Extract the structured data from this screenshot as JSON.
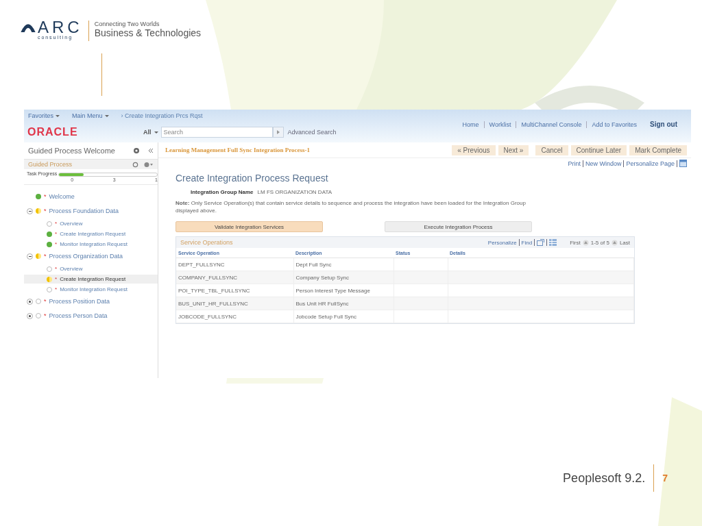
{
  "brand": {
    "logo": "ARC",
    "logo_sub": "c o n s u l t i n g",
    "tagline": "Connecting Two Worlds",
    "subtitle": "Business & Technologies"
  },
  "app": {
    "menus": [
      {
        "label": "Favorites"
      },
      {
        "label": "Main Menu"
      }
    ],
    "breadcrumb": "› Create Integration Prcs Rqst",
    "logo": "ORACLE",
    "search": {
      "scope": "All",
      "placeholder": "Search",
      "advanced": "Advanced Search"
    },
    "top_links": [
      {
        "label": "Home",
        "kind": "link"
      },
      {
        "label": "Worklist",
        "kind": "link"
      },
      {
        "label": "MultiChannel Console",
        "kind": "link"
      },
      {
        "label": "Add to Favorites",
        "kind": "link"
      },
      {
        "label": "Sign out",
        "kind": "strong"
      }
    ],
    "sidebar": {
      "title": "Guided Process Welcome",
      "panel_title": "Guided Process",
      "progress": {
        "label": "Task Progress",
        "level": 0.25,
        "ticks": [
          "0",
          "3",
          "1"
        ]
      },
      "tree": [
        {
          "label": "Welcome",
          "mark": "*",
          "kind": "complete",
          "selected": false
        },
        {
          "label": "Process Foundation Data",
          "mark": "*",
          "kind": "partial",
          "selected": false,
          "expanded": true,
          "children": [
            {
              "label": "Overview",
              "mark": "*",
              "kind": "none",
              "selected": false
            },
            {
              "label": "Create Integration Request",
              "mark": "*",
              "kind": "complete",
              "selected": false
            },
            {
              "label": "Monitor Integration Request",
              "mark": "*",
              "kind": "complete",
              "selected": false
            }
          ]
        },
        {
          "label": "Process Organization Data",
          "mark": "*",
          "kind": "partial",
          "selected": false,
          "expanded": true,
          "children": [
            {
              "label": "Overview",
              "mark": "*",
              "kind": "none",
              "selected": false
            },
            {
              "label": "Create Integration Request",
              "mark": "*",
              "kind": "partial",
              "selected": true
            },
            {
              "label": "Monitor Integration Request",
              "mark": "*",
              "kind": "none",
              "selected": false
            }
          ]
        },
        {
          "label": "Process Position Data",
          "mark": "*",
          "kind": "none",
          "selected": false,
          "expanded": false
        },
        {
          "label": "Process Person Data",
          "mark": "*",
          "kind": "none",
          "selected": false,
          "expanded": false
        }
      ]
    },
    "process_title": "Learning Management Full Sync Integration Process-1",
    "nav_buttons": [
      {
        "label": "« Previous"
      },
      {
        "label": "Next »"
      },
      {
        "label": "Cancel"
      },
      {
        "label": "Continue Later"
      },
      {
        "label": "Mark Complete"
      }
    ],
    "page_links": [
      "Print",
      "New Window",
      "Personalize Page"
    ],
    "page_title": "Create Integration Process Request",
    "group_field": {
      "label": "Integration Group Name",
      "value": "LM FS ORGANIZATION DATA"
    },
    "note": "**Note:** Only Service Operation(s) that contain service details to sequence and process the integration have been loaded for the Integration Group displayed above.",
    "action_buttons": [
      {
        "label": "Validate Integration Services",
        "selected": true
      },
      {
        "label": "Execute Integration Process",
        "selected": false
      }
    ],
    "grid": {
      "title": "Service Operations",
      "tools": [
        "Personalize",
        "Find"
      ],
      "pager": {
        "first": "First",
        "range": "1-5 of 5",
        "last": "Last"
      },
      "columns": [
        "Service Operation",
        "Description",
        "Status",
        "Details"
      ],
      "rows": [
        [
          "DEPT_FULLSYNC",
          "Dept Full Sync"
        ],
        [
          "COMPANY_FULLSYNC",
          "Company Setup Sync"
        ],
        [
          "POI_TYPE_TBL_FULLSYNC",
          "Person Interest Type Message"
        ],
        [
          "BUS_UNIT_HR_FULLSYNC",
          "Bus Unit HR FullSync"
        ],
        [
          "JOBCODE_FULLSYNC",
          "Jobcode Setup Full Sync"
        ]
      ]
    }
  },
  "footer": {
    "title": "Peoplesoft 9.2.",
    "page": "7"
  }
}
